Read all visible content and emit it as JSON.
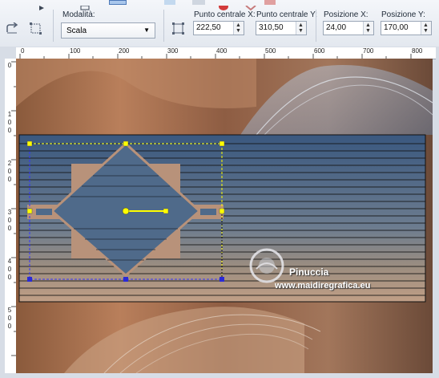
{
  "toolbar": {
    "mode_label": "Modalità:",
    "mode_value": "Scala",
    "center_x_label": "Punto centrale X:",
    "center_x_value": "222,50",
    "center_y_label": "Punto centrale Y:",
    "center_y_value": "310,50",
    "pos_x_label": "Posizione X:",
    "pos_x_value": "24,00",
    "pos_y_label": "Posizione Y:",
    "pos_y_value": "170,00"
  },
  "ruler": {
    "h_ticks": [
      "0",
      "100",
      "200",
      "300",
      "400",
      "500",
      "600",
      "700",
      "800"
    ],
    "v_ticks": [
      [
        "0"
      ],
      [
        "1",
        "0",
        "0"
      ],
      [
        "2",
        "0",
        "0"
      ],
      [
        "3",
        "0",
        "0"
      ],
      [
        "4",
        "0",
        "0"
      ],
      [
        "5",
        "0",
        "0"
      ]
    ]
  },
  "watermark": {
    "name": "Pinuccia",
    "site": "www.maidiregrafica.eu"
  },
  "colors": {
    "deform_handle": "#ffff00",
    "selection_handle": "#2a2ad6",
    "tan": "#b8927a",
    "blue_band": "#3d5a82"
  }
}
